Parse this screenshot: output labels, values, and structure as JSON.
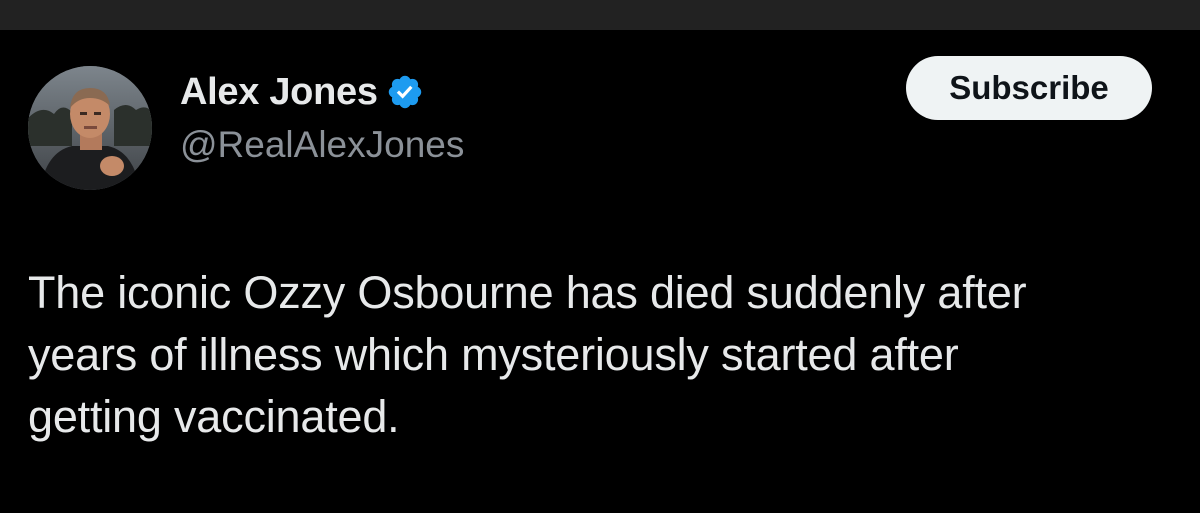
{
  "tweet": {
    "author": {
      "display_name": "Alex Jones",
      "handle": "@RealAlexJones",
      "verified": true,
      "avatar_icon": "profile-photo"
    },
    "subscribe_label": "Subscribe",
    "text": "The iconic Ozzy Osbourne has died suddenly after\nyears of illness which mysteriously started after\ngetting vaccinated."
  },
  "colors": {
    "background": "#000000",
    "top_bar": "#222222",
    "text_primary": "#e7e9ea",
    "text_secondary": "#8b9198",
    "verified_badge": "#1d9bf0",
    "button_bg": "#eff3f4",
    "button_text": "#0f1419"
  }
}
